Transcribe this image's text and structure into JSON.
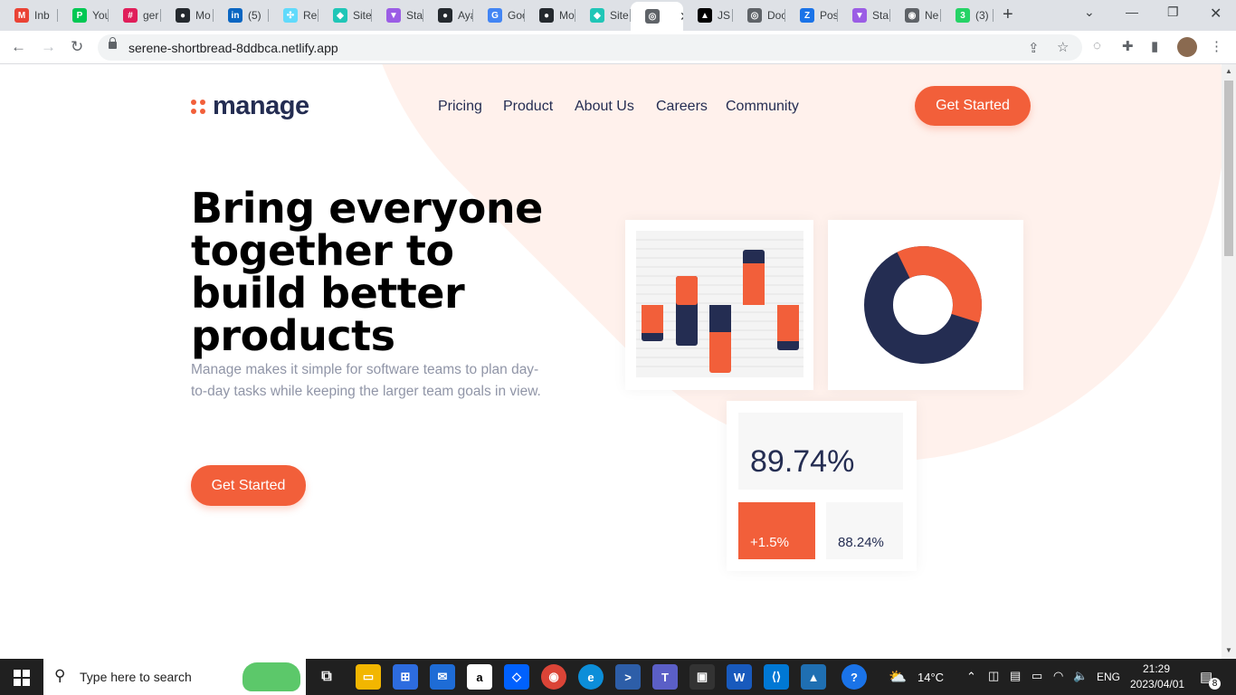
{
  "browser": {
    "tabs": [
      {
        "label": "Inb",
        "icon": "gmail-icon",
        "color": "#ea4335",
        "glyph": "M"
      },
      {
        "label": "You",
        "icon": "pluralsight-icon",
        "color": "#00c853",
        "glyph": "P"
      },
      {
        "label": "ger",
        "icon": "slack-icon",
        "color": "#e01e5a",
        "glyph": "#"
      },
      {
        "label": "Mo",
        "icon": "github-icon",
        "color": "#24292e",
        "glyph": "●"
      },
      {
        "label": "(5)",
        "icon": "linkedin-icon",
        "color": "#0a66c2",
        "glyph": "in"
      },
      {
        "label": "Rea",
        "icon": "react-icon",
        "color": "#61dafb",
        "glyph": "✣"
      },
      {
        "label": "Site",
        "icon": "netlify-icon",
        "color": "#20c6b7",
        "glyph": "◆"
      },
      {
        "label": "Sta",
        "icon": "vite-icon",
        "color": "#9b5de5",
        "glyph": "▼"
      },
      {
        "label": "Aya",
        "icon": "github-icon",
        "color": "#24292e",
        "glyph": "●"
      },
      {
        "label": "Goo",
        "icon": "google-icon",
        "color": "#4285f4",
        "glyph": "G"
      },
      {
        "label": "Mo",
        "icon": "github-icon",
        "color": "#24292e",
        "glyph": "●"
      },
      {
        "label": "Site",
        "icon": "netlify-icon",
        "color": "#20c6b7",
        "glyph": "◆"
      },
      {
        "label": "",
        "icon": "globe-icon",
        "color": "#5f6368",
        "glyph": "◎",
        "active": true
      },
      {
        "label": "JS I",
        "icon": "vercel-icon",
        "color": "#000000",
        "glyph": "▲"
      },
      {
        "label": "Doc",
        "icon": "globe-icon",
        "color": "#5f6368",
        "glyph": "◎"
      },
      {
        "label": "Pos",
        "icon": "zoho-icon",
        "color": "#1a73e8",
        "glyph": "Z"
      },
      {
        "label": "Sta",
        "icon": "vite-icon",
        "color": "#9b5de5",
        "glyph": "▼"
      },
      {
        "label": "Ne",
        "icon": "chrome-icon",
        "color": "#5f6368",
        "glyph": "◉"
      },
      {
        "label": "(3)",
        "icon": "whatsapp-icon",
        "color": "#25d366",
        "glyph": "3"
      }
    ],
    "url": "serene-shortbread-8ddbca.netlify.app"
  },
  "page": {
    "logo_text": "manage",
    "nav": [
      "Pricing",
      "Product",
      "About Us",
      "Careers",
      "Community"
    ],
    "header_cta": "Get Started",
    "hero_title": "Bring everyone together to build better products",
    "hero_description": "Manage makes it simple for software teams to plan day-to-day tasks while keeping the larger team goals in view.",
    "hero_cta": "Get Started",
    "stats": {
      "main": "89.74%",
      "delta": "+1.5%",
      "secondary": "88.24%"
    },
    "donut_fraction_orange": 0.37,
    "colors": {
      "accent": "#f25f3a",
      "navy": "#242d52",
      "bg_shape": "#fff1ec"
    }
  },
  "taskbar": {
    "search_placeholder": "Type here to search",
    "weather": "14°C",
    "lang": "ENG",
    "time": "21:29",
    "date": "2023/04/01",
    "notifications": "8"
  }
}
